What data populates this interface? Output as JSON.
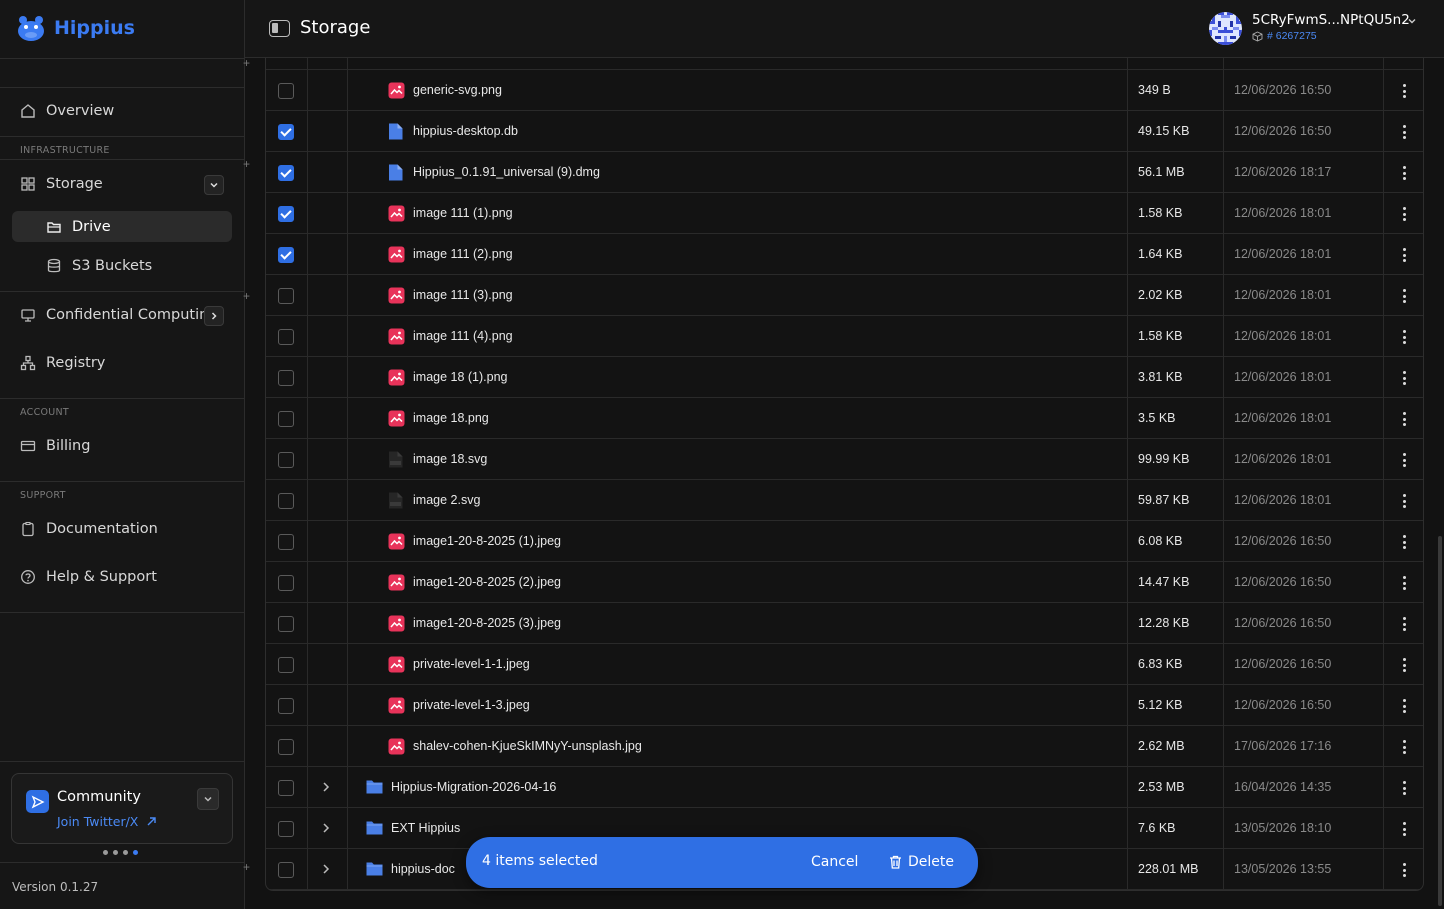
{
  "app": {
    "name": "Hippius",
    "version": "Version 0.1.27"
  },
  "header": {
    "title": "Storage",
    "account_name": "5CRyFwmS...NPtQU5n2",
    "account_id": "# 6267275"
  },
  "sidebar": {
    "overview": "Overview",
    "infrastructure_label": "INFRASTRUCTURE",
    "storage": "Storage",
    "drive": "Drive",
    "s3_buckets": "S3 Buckets",
    "confidential": "Confidential Computing",
    "registry": "Registry",
    "account_label": "ACCOUNT",
    "billing": "Billing",
    "support_label": "SUPPORT",
    "documentation": "Documentation",
    "help": "Help & Support",
    "community_title": "Community",
    "community_link": "Join Twitter/X"
  },
  "files": [
    {
      "name": "generic-svg.png",
      "size": "349 B",
      "date": "12/06/2026 16:50",
      "type": "image",
      "checked": false
    },
    {
      "name": "hippius-desktop.db",
      "size": "49.15 KB",
      "date": "12/06/2026 16:50",
      "type": "doc",
      "checked": true
    },
    {
      "name": "Hippius_0.1.91_universal (9).dmg",
      "size": "56.1 MB",
      "date": "12/06/2026 18:17",
      "type": "doc",
      "checked": true
    },
    {
      "name": "image 111 (1).png",
      "size": "1.58 KB",
      "date": "12/06/2026 18:01",
      "type": "image",
      "checked": true
    },
    {
      "name": "image 111 (2).png",
      "size": "1.64 KB",
      "date": "12/06/2026 18:01",
      "type": "image",
      "checked": true
    },
    {
      "name": "image 111 (3).png",
      "size": "2.02 KB",
      "date": "12/06/2026 18:01",
      "type": "image",
      "checked": false
    },
    {
      "name": "image 111 (4).png",
      "size": "1.58 KB",
      "date": "12/06/2026 18:01",
      "type": "image",
      "checked": false
    },
    {
      "name": "image 18 (1).png",
      "size": "3.81 KB",
      "date": "12/06/2026 18:01",
      "type": "image",
      "checked": false
    },
    {
      "name": "image 18.png",
      "size": "3.5 KB",
      "date": "12/06/2026 18:01",
      "type": "image",
      "checked": false
    },
    {
      "name": "image 18.svg",
      "size": "99.99 KB",
      "date": "12/06/2026 18:01",
      "type": "svg",
      "checked": false
    },
    {
      "name": "image 2.svg",
      "size": "59.87 KB",
      "date": "12/06/2026 18:01",
      "type": "svg",
      "checked": false
    },
    {
      "name": "image1-20-8-2025 (1).jpeg",
      "size": "6.08 KB",
      "date": "12/06/2026 16:50",
      "type": "image",
      "checked": false
    },
    {
      "name": "image1-20-8-2025 (2).jpeg",
      "size": "14.47 KB",
      "date": "12/06/2026 16:50",
      "type": "image",
      "checked": false
    },
    {
      "name": "image1-20-8-2025 (3).jpeg",
      "size": "12.28 KB",
      "date": "12/06/2026 16:50",
      "type": "image",
      "checked": false
    },
    {
      "name": "private-level-1-1.jpeg",
      "size": "6.83 KB",
      "date": "12/06/2026 16:50",
      "type": "image",
      "checked": false
    },
    {
      "name": "private-level-1-3.jpeg",
      "size": "5.12 KB",
      "date": "12/06/2026 16:50",
      "type": "image",
      "checked": false
    },
    {
      "name": "shalev-cohen-KjueSkIMNyY-unsplash.jpg",
      "size": "2.62 MB",
      "date": "17/06/2026 17:16",
      "type": "image",
      "checked": false
    },
    {
      "name": "Hippius-Migration-2026-04-16",
      "size": "2.53 MB",
      "date": "16/04/2026 14:35",
      "type": "folder",
      "checked": false
    },
    {
      "name": "EXT Hippius",
      "size": "7.6 KB",
      "date": "13/05/2026 18:10",
      "type": "folder",
      "checked": false
    },
    {
      "name": "hippius-doc",
      "size": "228.01 MB",
      "date": "13/05/2026 13:55",
      "type": "folder",
      "checked": false
    }
  ],
  "selection": {
    "count_text": "4 items selected",
    "cancel": "Cancel",
    "delete": "Delete"
  },
  "colors": {
    "accent": "#2f6fe4",
    "image_icon": "#e8335a",
    "file_icon": "#4a7fe6"
  }
}
